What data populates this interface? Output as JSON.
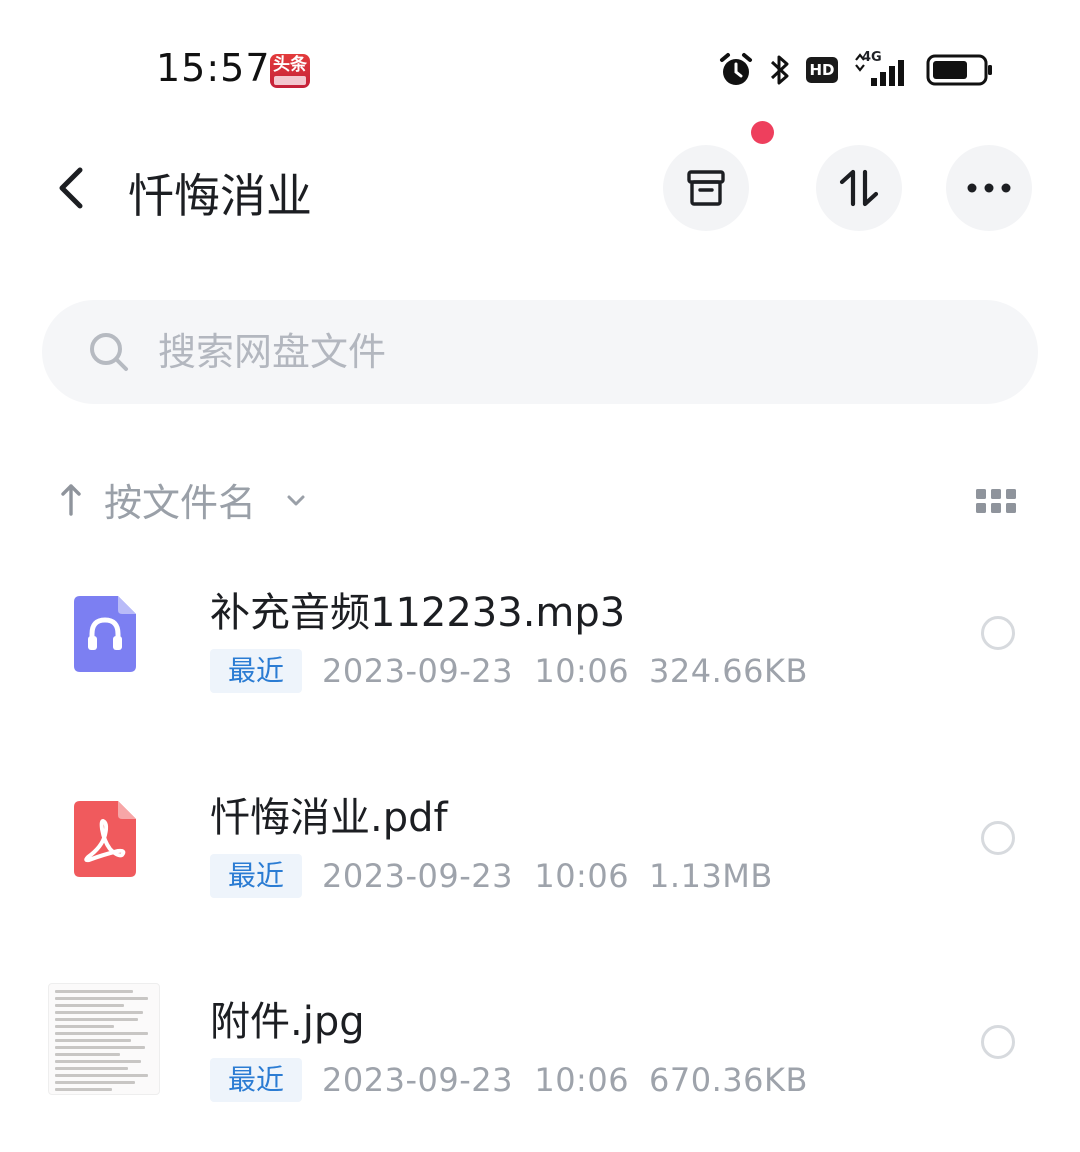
{
  "status_bar": {
    "time": "15:57",
    "news_app_label": "头条",
    "hd_label": "HD",
    "network_label": "4G"
  },
  "header": {
    "title": "忏悔消业"
  },
  "search": {
    "placeholder": "搜索网盘文件"
  },
  "sort": {
    "label": "按文件名"
  },
  "files": [
    {
      "name": "补充音频112233.mp3",
      "tag": "最近",
      "date": "2023-09-23  10:06",
      "size": "324.66KB",
      "icon": "audio-file-icon",
      "color": "#7c7ff2"
    },
    {
      "name": "忏悔消业.pdf",
      "tag": "最近",
      "date": "2023-09-23  10:06",
      "size": "1.13MB",
      "icon": "pdf-file-icon",
      "color": "#f05a5d"
    },
    {
      "name": "附件.jpg",
      "tag": "最近",
      "date": "2023-09-23  10:06",
      "size": "670.36KB",
      "icon": "image-thumbnail",
      "color": "#fbfafa"
    }
  ],
  "colors": {
    "accent_tag": "#2b7cd3",
    "notification_dot": "#ee3f5d"
  }
}
